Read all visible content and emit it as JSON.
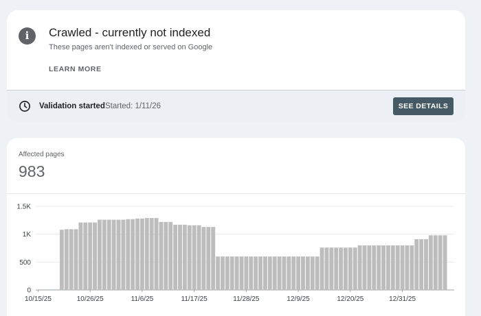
{
  "issue": {
    "icon": "info-icon",
    "title": "Crawled - currently not indexed",
    "subtitle": "These pages aren't indexed or served on Google",
    "learn_more_label": "LEARN MORE"
  },
  "validation": {
    "icon": "clock-icon",
    "status": "Validation started",
    "started": "Started: 1/11/26",
    "see_details_label": "SEE DETAILS"
  },
  "metric": {
    "label": "Affected pages",
    "value": "983"
  },
  "colors": {
    "bar": "#bdbdbd",
    "button": "#455a64",
    "grid": "#e8eaed"
  },
  "chart_data": {
    "type": "bar",
    "ylim": [
      0,
      1500
    ],
    "y_ticks": [
      {
        "value": 0,
        "label": "0"
      },
      {
        "value": 500,
        "label": "500"
      },
      {
        "value": 1000,
        "label": "1K"
      },
      {
        "value": 1500,
        "label": "1.5K"
      }
    ],
    "x_tick_labels": [
      "10/15/25",
      "10/26/25",
      "11/6/25",
      "11/17/25",
      "11/28/25",
      "12/9/25",
      "12/20/25",
      "12/31/25"
    ],
    "x_tick_every": 11,
    "grid": true,
    "legend": "none",
    "values": [
      0,
      0,
      0,
      0,
      0,
      1080,
      1090,
      1090,
      1090,
      1210,
      1210,
      1210,
      1210,
      1260,
      1260,
      1260,
      1260,
      1260,
      1260,
      1270,
      1270,
      1280,
      1280,
      1290,
      1290,
      1290,
      1220,
      1220,
      1220,
      1170,
      1170,
      1170,
      1160,
      1160,
      1160,
      1130,
      1130,
      1130,
      600,
      600,
      600,
      600,
      600,
      600,
      600,
      600,
      600,
      600,
      600,
      600,
      600,
      600,
      600,
      600,
      600,
      600,
      600,
      600,
      600,
      600,
      760,
      760,
      760,
      760,
      760,
      760,
      760,
      760,
      800,
      800,
      800,
      800,
      800,
      800,
      800,
      800,
      800,
      800,
      800,
      800,
      910,
      910,
      910,
      980,
      980,
      980,
      980
    ]
  }
}
